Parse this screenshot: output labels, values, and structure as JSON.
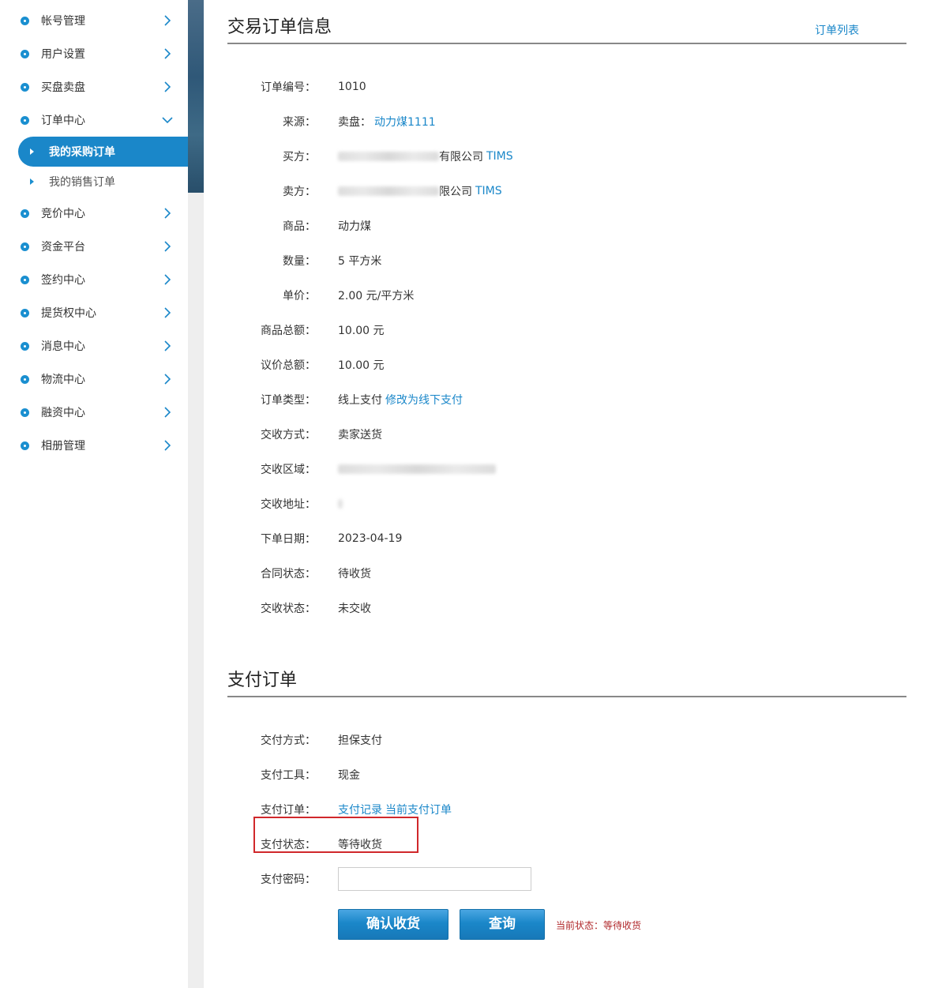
{
  "sidebar": {
    "items": [
      {
        "label": "帐号管理"
      },
      {
        "label": "用户设置"
      },
      {
        "label": "买盘卖盘"
      },
      {
        "label": "订单中心"
      },
      {
        "label": "竞价中心"
      },
      {
        "label": "资金平台"
      },
      {
        "label": "签约中心"
      },
      {
        "label": "提货权中心"
      },
      {
        "label": "消息中心"
      },
      {
        "label": "物流中心"
      },
      {
        "label": "融资中心"
      },
      {
        "label": "相册管理"
      }
    ],
    "sub_items": [
      {
        "label": "我的采购订单",
        "active": true
      },
      {
        "label": "我的销售订单",
        "active": false
      }
    ]
  },
  "order_section": {
    "title": "交易订单信息",
    "list_link": "订单列表",
    "rows": {
      "order_no": {
        "label": "订单编号：",
        "value": "1010"
      },
      "source": {
        "label": "来源：",
        "prefix": "卖盘：",
        "link": "动力煤1111"
      },
      "buyer": {
        "label": "买方：",
        "suffix": "有限公司",
        "link": "TIMS"
      },
      "seller": {
        "label": "卖方：",
        "suffix": "限公司",
        "link": "TIMS"
      },
      "product": {
        "label": "商品：",
        "value": "动力煤"
      },
      "quantity": {
        "label": "数量：",
        "value": "5 平方米"
      },
      "unit_price": {
        "label": "单价：",
        "value": "2.00 元/平方米"
      },
      "total": {
        "label": "商品总额：",
        "value": "10.00 元"
      },
      "negotiated_total": {
        "label": "议价总额：",
        "value": "10.00 元"
      },
      "order_type": {
        "label": "订单类型：",
        "value": "线上支付",
        "link": "修改为线下支付"
      },
      "delivery_method": {
        "label": "交收方式：",
        "value": "卖家送货"
      },
      "delivery_area": {
        "label": "交收区域：",
        "value": ""
      },
      "delivery_address": {
        "label": "交收地址：",
        "value": ""
      },
      "order_date": {
        "label": "下单日期：",
        "value": "2023-04-19"
      },
      "contract_status": {
        "label": "合同状态：",
        "value": "待收货"
      },
      "delivery_status": {
        "label": "交收状态：",
        "value": "未交收"
      }
    }
  },
  "payment_section": {
    "title": "支付订单",
    "rows": {
      "pay_method": {
        "label": "交付方式：",
        "value": "担保支付"
      },
      "pay_tool": {
        "label": "支付工具：",
        "value": "现金"
      },
      "pay_order": {
        "label": "支付订单：",
        "link1": "支付记录",
        "link2": "当前支付订单"
      },
      "pay_status": {
        "label": "支付状态：",
        "value": "等待收货"
      },
      "pay_password": {
        "label": "支付密码：",
        "value": ""
      }
    },
    "buttons": {
      "confirm": "确认收货",
      "query": "查询"
    },
    "status_note": "当前状态：等待收货",
    "highlight_color": "#d0282b"
  },
  "colors": {
    "accent": "#1a87c9",
    "status_red": "#b0282b"
  }
}
